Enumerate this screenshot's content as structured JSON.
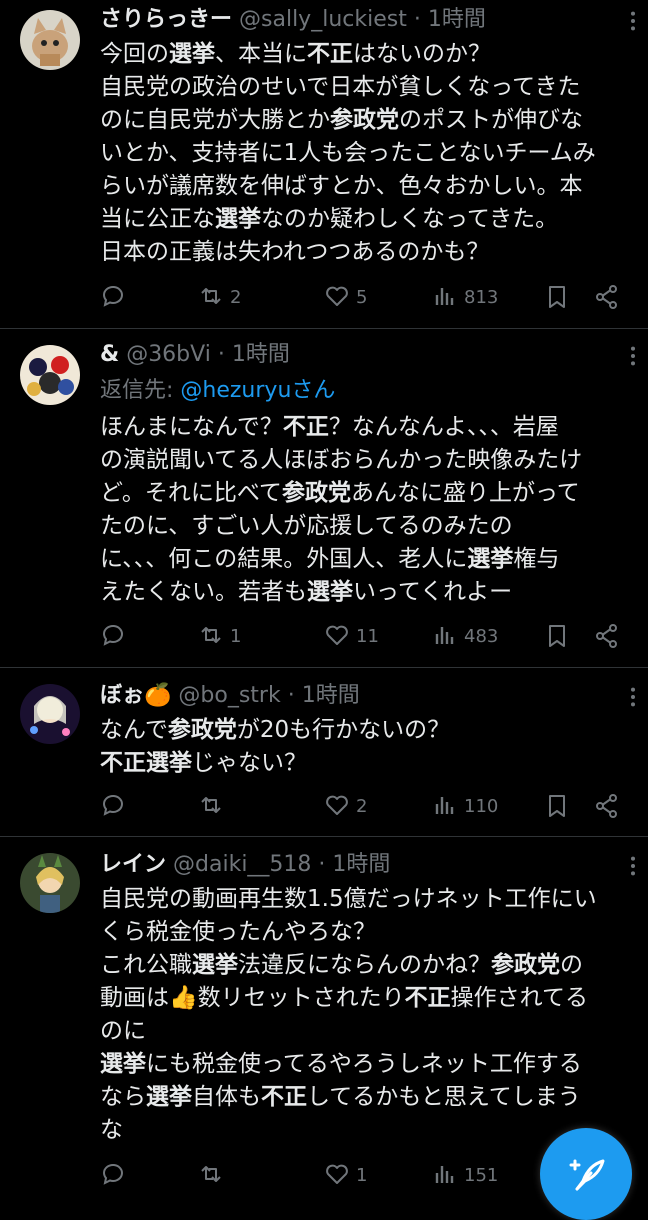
{
  "tweets": [
    {
      "name": "さりらっきー",
      "handle": "@sally_luckiest",
      "sep": "·",
      "time": "1時間",
      "reply_prefix": "",
      "reply_mention": "",
      "reply_suffix": "",
      "lines": [
        [
          {
            "t": "今回の"
          },
          {
            "t": "選挙",
            "b": true
          },
          {
            "t": "、本当に"
          },
          {
            "t": "不正",
            "b": true
          },
          {
            "t": "はないのか？"
          }
        ],
        [
          {
            "t": "自民党の政治のせいで日本が貧しくなってきた"
          }
        ],
        [
          {
            "t": "のに自民党が大勝とか"
          },
          {
            "t": "参政党",
            "b": true
          },
          {
            "t": "のポストが伸びな"
          }
        ],
        [
          {
            "t": "いとか、支持者に1人も会ったことないチームみ"
          }
        ],
        [
          {
            "t": "らいが議席数を伸ばすとか、色々おかしい。本"
          }
        ],
        [
          {
            "t": "当に公正な"
          },
          {
            "t": "選挙",
            "b": true
          },
          {
            "t": "なのか疑わしくなってきた。"
          }
        ],
        [
          {
            "t": "日本の正義は失われつつあるのかも？"
          }
        ]
      ],
      "retweets": "2",
      "likes": "5",
      "views": "813"
    },
    {
      "name": "&",
      "handle": "@36bVi",
      "sep": "·",
      "time": "1時間",
      "reply_prefix": "返信先: ",
      "reply_mention": "@hezuryu",
      "reply_suffix": "さん",
      "lines": [
        [
          {
            "t": "ほんまになんで？"
          },
          {
            "t": "不正",
            "b": true
          },
          {
            "t": "？なんなんよ、、、岩屋"
          }
        ],
        [
          {
            "t": "の演説聞いてる人ほぼおらんかった映像みたけ"
          }
        ],
        [
          {
            "t": "ど。それに比べて"
          },
          {
            "t": "参政党",
            "b": true
          },
          {
            "t": "あんなに盛り上がって"
          }
        ],
        [
          {
            "t": "たのに、すごい人が応援してるのみたの"
          }
        ],
        [
          {
            "t": "に、、、何この結果。外国人、老人に"
          },
          {
            "t": "選挙",
            "b": true
          },
          {
            "t": "権与"
          }
        ],
        [
          {
            "t": "えたくない。若者も"
          },
          {
            "t": "選挙",
            "b": true
          },
          {
            "t": "いってくれよー"
          }
        ]
      ],
      "retweets": "1",
      "likes": "11",
      "views": "483"
    },
    {
      "name": "ぼぉ🍊",
      "handle": "@bo_strk",
      "sep": "·",
      "time": "1時間",
      "reply_prefix": "",
      "reply_mention": "",
      "reply_suffix": "",
      "lines": [
        [
          {
            "t": "なんで"
          },
          {
            "t": "参政党",
            "b": true
          },
          {
            "t": "が20も行かないの？"
          }
        ],
        [
          {
            "t": "不正選挙",
            "b": true
          },
          {
            "t": "じゃない？"
          }
        ]
      ],
      "retweets": "",
      "likes": "2",
      "views": "110"
    },
    {
      "name": "レイン",
      "handle": "@daiki__518",
      "sep": "·",
      "time": "1時間",
      "reply_prefix": "",
      "reply_mention": "",
      "reply_suffix": "",
      "lines": [
        [
          {
            "t": "自民党の動画再生数1.5億だっけネット工作にい"
          }
        ],
        [
          {
            "t": "くら税金使ったんやろな？"
          }
        ],
        [
          {
            "t": "これ公職"
          },
          {
            "t": "選挙",
            "b": true
          },
          {
            "t": "法違反にならんのかね？"
          },
          {
            "t": "参政党",
            "b": true
          },
          {
            "t": "の"
          }
        ],
        [
          {
            "t": "動画は👍数リセットされたり"
          },
          {
            "t": "不正",
            "b": true
          },
          {
            "t": "操作されてる"
          }
        ],
        [
          {
            "t": "のに"
          }
        ],
        [
          {
            "t": "選挙",
            "b": true
          },
          {
            "t": "にも税金使ってるやろうしネット工作する"
          }
        ],
        [
          {
            "t": "なら"
          },
          {
            "t": "選挙",
            "b": true
          },
          {
            "t": "自体も"
          },
          {
            "t": "不正",
            "b": true
          },
          {
            "t": "してるかもと思えてしまう"
          }
        ],
        [
          {
            "t": "な"
          }
        ]
      ],
      "retweets": "",
      "likes": "1",
      "views": "151"
    }
  ],
  "icons": {
    "reply": "reply-icon",
    "retweet": "retweet-icon",
    "like": "like-icon",
    "views": "views-icon",
    "bookmark": "bookmark-icon",
    "share": "share-icon",
    "more": "more-icon",
    "compose": "compose-icon"
  },
  "colors": {
    "background": "#000000",
    "text": "#e7e9ea",
    "secondary": "#71767b",
    "accent": "#1d9bf0",
    "divider": "#2f3336"
  }
}
